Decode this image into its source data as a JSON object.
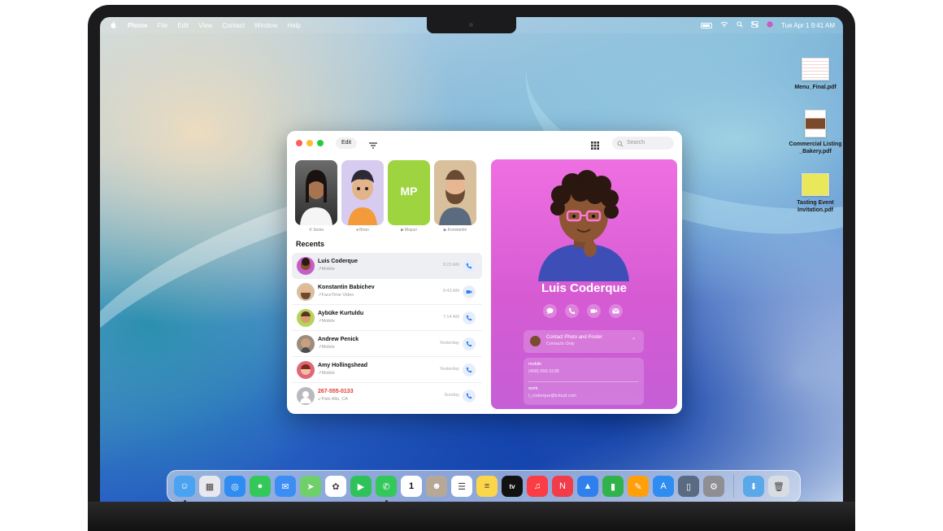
{
  "menubar": {
    "app_name": "Phone",
    "menus": [
      "File",
      "Edit",
      "View",
      "Contact",
      "Window",
      "Help"
    ],
    "datetime": "Tue Apr 1  9:41 AM"
  },
  "desktop": {
    "files": [
      "Menu_Final.pdf",
      "Commercial Listing _Bakery.pdf",
      "Tasting Event Invitation.pdf"
    ]
  },
  "window": {
    "edit_label": "Edit",
    "search_placeholder": "Search",
    "favorites": [
      {
        "name": "Sonia",
        "icon": "phone-icon",
        "color": "#3b3b3b"
      },
      {
        "name": "Brian",
        "icon": "message-icon",
        "color": "#d7ccef"
      },
      {
        "name": "Mayuri",
        "icon": "video-icon",
        "initials": "MP",
        "color": "#9ed43f"
      },
      {
        "name": "Konstantin",
        "icon": "video-icon",
        "color": "#d9c09c"
      }
    ],
    "recents_title": "Recents",
    "recents": [
      {
        "name": "Luis Coderque",
        "detail": "↗Mobile",
        "time": "9:23 AM",
        "action": "phone-icon",
        "avatar": "#8a4d2c",
        "red": false
      },
      {
        "name": "Konstantin Babichev",
        "detail": "↗FaceTime Video",
        "time": "9:43 AM",
        "action": "video-icon",
        "avatar": "#c9a27a",
        "red": false
      },
      {
        "name": "Aybüke Kurtuldu",
        "detail": "↗Mobile",
        "time": "7:14 AM",
        "action": "phone-icon",
        "avatar": "#b4d45b",
        "red": false
      },
      {
        "name": "Andrew Penick",
        "detail": "↗Mobile",
        "time": "Yesterday",
        "action": "phone-icon",
        "avatar": "#9a8c7e",
        "red": false
      },
      {
        "name": "Amy Hollingshead",
        "detail": "↗Mobile",
        "time": "Yesterday",
        "action": "phone-icon",
        "avatar": "#e0667a",
        "red": false
      },
      {
        "name": "267-555-0133",
        "detail": "↙Palo Alto, CA",
        "time": "Sunday",
        "action": "phone-icon",
        "avatar": "#b9b9be",
        "red": true
      }
    ],
    "contact": {
      "name": "Luis Coderque",
      "poster_title": "Contact Photo and Poster",
      "poster_subtitle": "Contacts Only",
      "mobile_label": "mobile",
      "mobile_value": "(408) 555-3138",
      "work_label": "work",
      "work_value": "l_coderque@icloud.com"
    }
  },
  "dock": {
    "apps": [
      {
        "name": "finder",
        "color": "#4aa3f0",
        "glyph": "☺"
      },
      {
        "name": "launchpad",
        "color": "#e8e8ee",
        "glyph": "▦"
      },
      {
        "name": "safari",
        "color": "#2f8cf0",
        "glyph": "◎"
      },
      {
        "name": "messages",
        "color": "#34c759",
        "glyph": "●"
      },
      {
        "name": "mail",
        "color": "#3c8ef5",
        "glyph": "✉"
      },
      {
        "name": "maps",
        "color": "#6fcf6a",
        "glyph": "➤"
      },
      {
        "name": "photos",
        "color": "#ffffff",
        "glyph": "✿"
      },
      {
        "name": "facetime",
        "color": "#2fc25b",
        "glyph": "▶"
      },
      {
        "name": "phone",
        "color": "#34c759",
        "glyph": "✆"
      },
      {
        "name": "calendar",
        "color": "#ffffff",
        "glyph": "1"
      },
      {
        "name": "contacts",
        "color": "#b6a897",
        "glyph": "☻"
      },
      {
        "name": "reminders",
        "color": "#ffffff",
        "glyph": "☰"
      },
      {
        "name": "notes",
        "color": "#fbd54a",
        "glyph": "≡"
      },
      {
        "name": "tv",
        "color": "#111111",
        "glyph": "tv"
      },
      {
        "name": "music",
        "color": "#fc3c44",
        "glyph": "♫"
      },
      {
        "name": "news",
        "color": "#f23c4a",
        "glyph": "N"
      },
      {
        "name": "keynote",
        "color": "#2f80ed",
        "glyph": "▲"
      },
      {
        "name": "numbers",
        "color": "#2fb34a",
        "glyph": "▮"
      },
      {
        "name": "pages",
        "color": "#ff9f0a",
        "glyph": "✎"
      },
      {
        "name": "app-store",
        "color": "#2f8cf0",
        "glyph": "A"
      },
      {
        "name": "iphone-mirroring",
        "color": "#5a6a82",
        "glyph": "▯"
      },
      {
        "name": "system-settings",
        "color": "#8e8e93",
        "glyph": "⚙"
      }
    ],
    "folder": {
      "name": "downloads",
      "color": "#5aa8e8",
      "glyph": "⬇"
    },
    "trash": {
      "name": "trash",
      "color": "#d8dde3",
      "glyph": "🗑"
    }
  }
}
